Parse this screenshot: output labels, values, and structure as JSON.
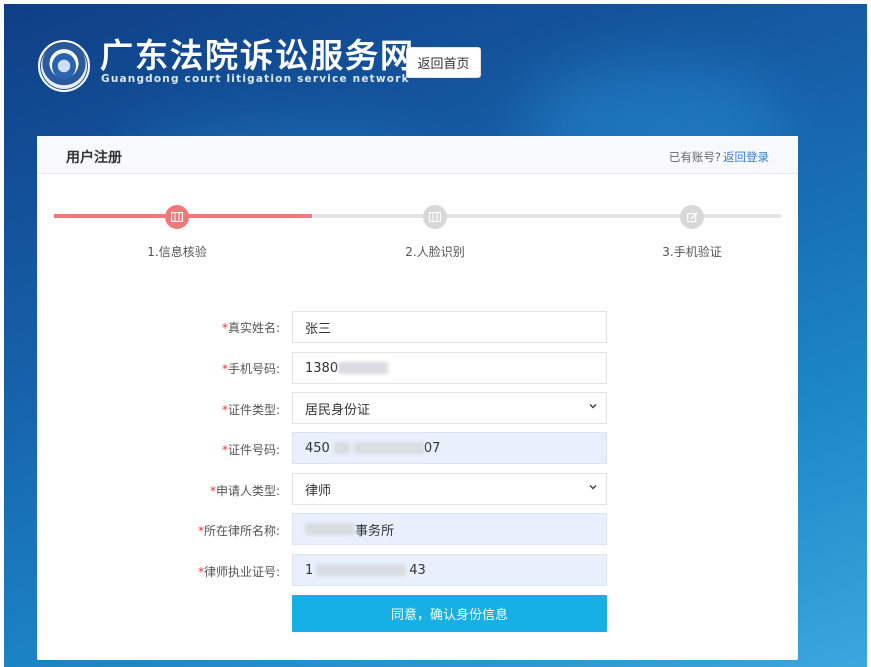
{
  "header": {
    "site_title": "广东法院诉讼服务网",
    "site_subtitle": "Guangdong court litigation service network",
    "home_button": "返回首页"
  },
  "card": {
    "title": "用户注册",
    "has_account": "已有账号?",
    "back_login": "返回登录"
  },
  "steps": [
    {
      "label": "1.信息核验",
      "active": true,
      "icon": "id-card-icon"
    },
    {
      "label": "2.人脸识别",
      "active": false,
      "icon": "id-card-icon"
    },
    {
      "label": "3.手机验证",
      "active": false,
      "icon": "edit-icon"
    }
  ],
  "progress": {
    "completed_steps": 1,
    "total_steps": 3
  },
  "form": {
    "required_mark": "*",
    "name": {
      "label": "真实姓名:",
      "value": "张三"
    },
    "phone": {
      "label": "手机号码:",
      "value_visible": "1380"
    },
    "id_type": {
      "label": "证件类型:",
      "value": "居民身份证"
    },
    "id_number": {
      "label": "证件号码:",
      "value_start": "450",
      "value_end": "07"
    },
    "applicant_type": {
      "label": "申请人类型:",
      "value": "律师"
    },
    "law_firm": {
      "label": "所在律所名称:",
      "value_end": "事务所"
    },
    "license_number": {
      "label": "律师执业证号:",
      "value_start": "1",
      "value_end": "43"
    },
    "confirm_button": "同意，确认身份信息"
  },
  "colors": {
    "accent_red": "#f07a7a",
    "button_blue": "#17b0e4",
    "link_blue": "#3a7bd5",
    "autofill_bg": "#e8f0fe"
  }
}
